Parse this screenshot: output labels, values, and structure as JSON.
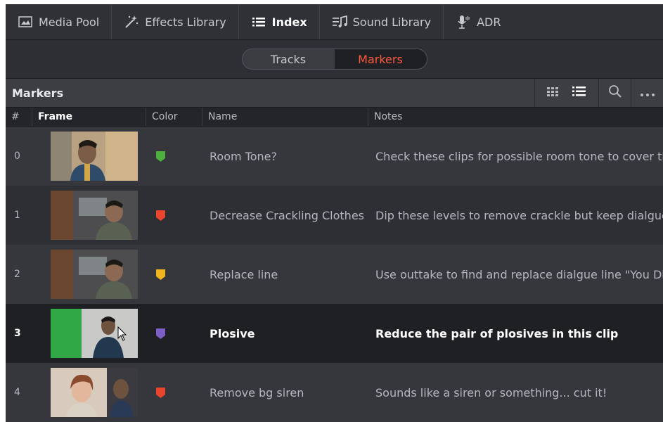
{
  "modules": [
    {
      "label": "Media Pool",
      "icon": "media-pool-icon",
      "active": false
    },
    {
      "label": "Effects Library",
      "icon": "effects-wand-icon",
      "active": false
    },
    {
      "label": "Index",
      "icon": "list-icon",
      "active": true
    },
    {
      "label": "Sound Library",
      "icon": "sound-library-icon",
      "active": false
    },
    {
      "label": "ADR",
      "icon": "microphone-icon",
      "active": false
    }
  ],
  "toggle": {
    "tracks": "Tracks",
    "markers": "Markers",
    "active": "Markers"
  },
  "panel": {
    "title": "Markers"
  },
  "columns": {
    "num": "#",
    "frame": "Frame",
    "color": "Color",
    "name": "Name",
    "notes": "Notes"
  },
  "rows": [
    {
      "num": "0",
      "color": "#4caf3e",
      "name": "Room Tone?",
      "notes": "Check these clips for possible room tone to cover the ..."
    },
    {
      "num": "1",
      "color": "#e8452c",
      "name": "Decrease Crackling Clothes",
      "notes": "Dip these levels to remove crackle but keep dialgue in..."
    },
    {
      "num": "2",
      "color": "#f2b51e",
      "name": "Replace line",
      "notes": "Use outtake to find and replace dialgue line \"You Died\""
    },
    {
      "num": "3",
      "color": "#7b5fc4",
      "name": "Plosive",
      "notes": "Reduce the pair of plosives in this clip"
    },
    {
      "num": "4",
      "color": "#e8452c",
      "name": "Remove bg siren",
      "notes": "Sounds like a siren or something... cut it!"
    }
  ],
  "colors": {
    "accent": "#ff5a3c",
    "background": "#2a2c31",
    "selected_row": "#1f2024"
  }
}
